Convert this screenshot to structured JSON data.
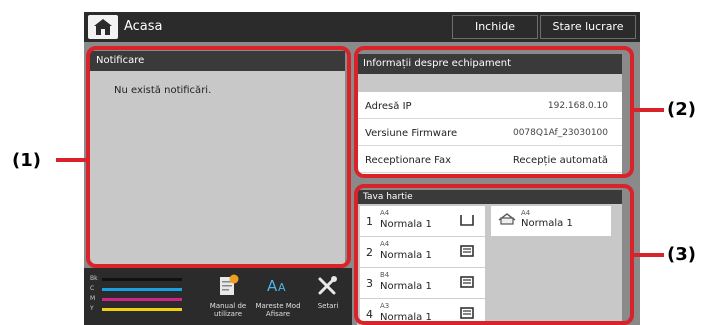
{
  "header": {
    "title": "Acasa",
    "close_label": "Inchide",
    "job_status_label": "Stare lucrare"
  },
  "notification": {
    "title": "Notificare",
    "message": "Nu există notificări."
  },
  "equipment_info": {
    "title": "Informații despre echipament",
    "rows": [
      {
        "label": "Adresă IP",
        "value": "192.168.0.10"
      },
      {
        "label": "Versiune Firmware",
        "value": "0078Q1Af_23030100"
      },
      {
        "label": "Receptionare Fax",
        "value": "Recepție automată"
      }
    ]
  },
  "paper_tray": {
    "title": "Tava hartie",
    "trays": [
      {
        "number": "1",
        "size": "A4",
        "type": "Normala 1"
      },
      {
        "number": "2",
        "size": "A4",
        "type": "Normala 1"
      },
      {
        "number": "3",
        "size": "B4",
        "type": "Normala 1"
      },
      {
        "number": "4",
        "size": "A3",
        "type": "Normala 1"
      }
    ],
    "bypass": {
      "size": "A4",
      "type": "Normala 1"
    }
  },
  "toner": [
    {
      "label": "Bk",
      "color": "#111111",
      "level": 1.0
    },
    {
      "label": "C",
      "color": "#1aa0e0",
      "level": 1.0
    },
    {
      "label": "M",
      "color": "#d0248c",
      "level": 1.0
    },
    {
      "label": "Y",
      "color": "#f0d010",
      "level": 1.0
    }
  ],
  "tools": {
    "manual_label": "Manual de utilizare",
    "enlarge_label": "Mareste Mod Afisare",
    "settings_label": "Setari"
  },
  "callouts": {
    "c1": "(1)",
    "c2": "(2)",
    "c3": "(3)"
  },
  "colors": {
    "callout_red": "#d8232a",
    "header_dark": "#2b2b2b"
  }
}
